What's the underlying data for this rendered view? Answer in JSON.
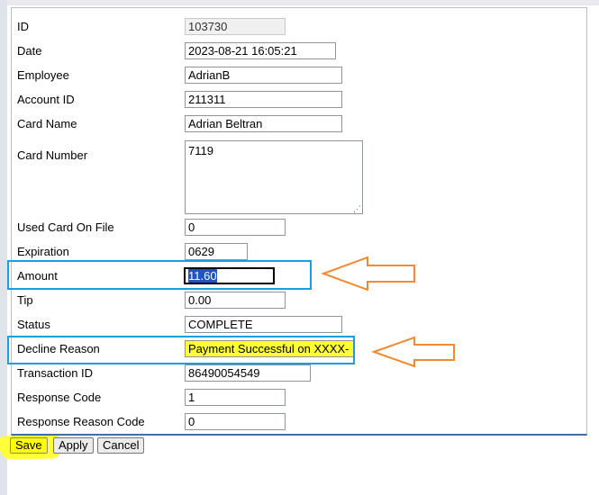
{
  "form": {
    "fields": {
      "id": {
        "label": "ID",
        "value": "103730"
      },
      "date": {
        "label": "Date",
        "value": "2023-08-21 16:05:21"
      },
      "employee": {
        "label": "Employee",
        "value": "AdrianB"
      },
      "account_id": {
        "label": "Account ID",
        "value": "211311"
      },
      "card_name": {
        "label": "Card Name",
        "value": "Adrian Beltran"
      },
      "card_number": {
        "label": "Card Number",
        "value": "7119"
      },
      "used_card_on_file": {
        "label": "Used Card On File",
        "value": "0"
      },
      "expiration": {
        "label": "Expiration",
        "value": "0629"
      },
      "amount": {
        "label": "Amount",
        "value": "11.60"
      },
      "tip": {
        "label": "Tip",
        "value": "0.00"
      },
      "status": {
        "label": "Status",
        "value": "COMPLETE"
      },
      "decline_reason": {
        "label": "Decline Reason",
        "value": "Payment Successful on XXXX-"
      },
      "transaction_id": {
        "label": "Transaction ID",
        "value": "86490054549"
      },
      "response_code": {
        "label": "Response Code",
        "value": "1"
      },
      "response_reason_code": {
        "label": "Response Reason Code",
        "value": "0"
      }
    }
  },
  "buttons": {
    "save": "Save",
    "apply": "Apply",
    "cancel": "Cancel"
  },
  "annotations": {
    "box_color": "#1a9ee0",
    "arrow_color": "#f28a30",
    "highlight_color": "#ffff33"
  }
}
